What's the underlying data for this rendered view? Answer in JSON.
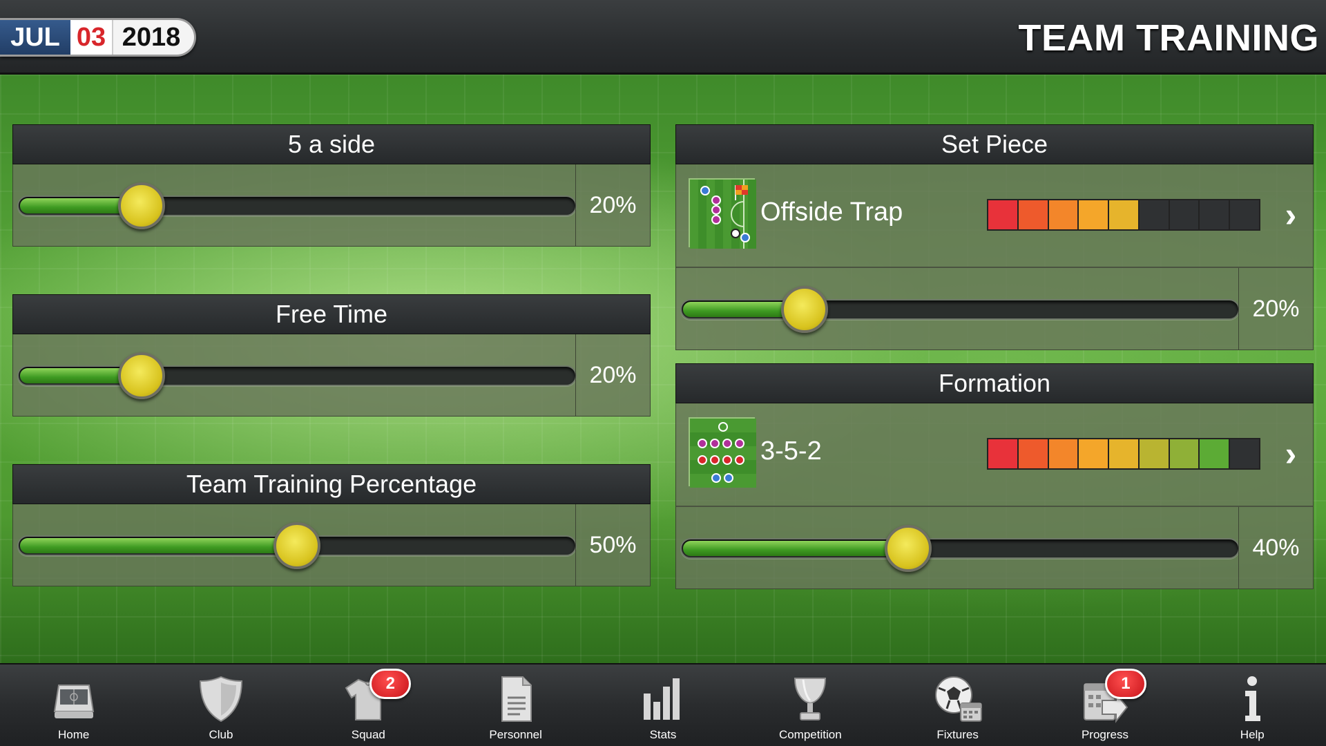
{
  "header": {
    "date": {
      "month": "JUL",
      "day": "03",
      "year": "2018"
    },
    "title": "TEAM TRAINING"
  },
  "left_panels": [
    {
      "title": "5 a side",
      "percent": 20,
      "value_label": "20%"
    },
    {
      "title": "Free Time",
      "percent": 20,
      "value_label": "20%"
    },
    {
      "title": "Team Training Percentage",
      "percent": 50,
      "value_label": "50%"
    }
  ],
  "set_piece": {
    "title": "Set Piece",
    "option_label": "Offside Trap",
    "option_icon": "set-piece-pitch-icon",
    "rating_filled": 5,
    "rating_total": 9,
    "percent": 20,
    "value_label": "20%"
  },
  "formation": {
    "title": "Formation",
    "option_label": "3-5-2",
    "option_icon": "formation-pitch-icon",
    "rating_filled": 8,
    "rating_total": 9,
    "percent": 40,
    "value_label": "40%"
  },
  "rating_colors": [
    "#e8323a",
    "#ee5a2c",
    "#f3862a",
    "#f4a62a",
    "#e6b42c",
    "#b9b431",
    "#8fb037",
    "#5cab35",
    "#2f3133"
  ],
  "rating_empty_color": "#2f3133",
  "nav": [
    {
      "label": "Home",
      "icon": "home-icon",
      "badge": ""
    },
    {
      "label": "Club",
      "icon": "shield-icon",
      "badge": ""
    },
    {
      "label": "Squad",
      "icon": "shirt-icon",
      "badge": "2"
    },
    {
      "label": "Personnel",
      "icon": "document-icon",
      "badge": ""
    },
    {
      "label": "Stats",
      "icon": "bar-chart-icon",
      "badge": ""
    },
    {
      "label": "Competition",
      "icon": "trophy-icon",
      "badge": ""
    },
    {
      "label": "Fixtures",
      "icon": "ball-calendar-icon",
      "badge": ""
    },
    {
      "label": "Progress",
      "icon": "calendar-arrow-icon",
      "badge": "1"
    },
    {
      "label": "Help",
      "icon": "info-icon",
      "badge": ""
    }
  ]
}
